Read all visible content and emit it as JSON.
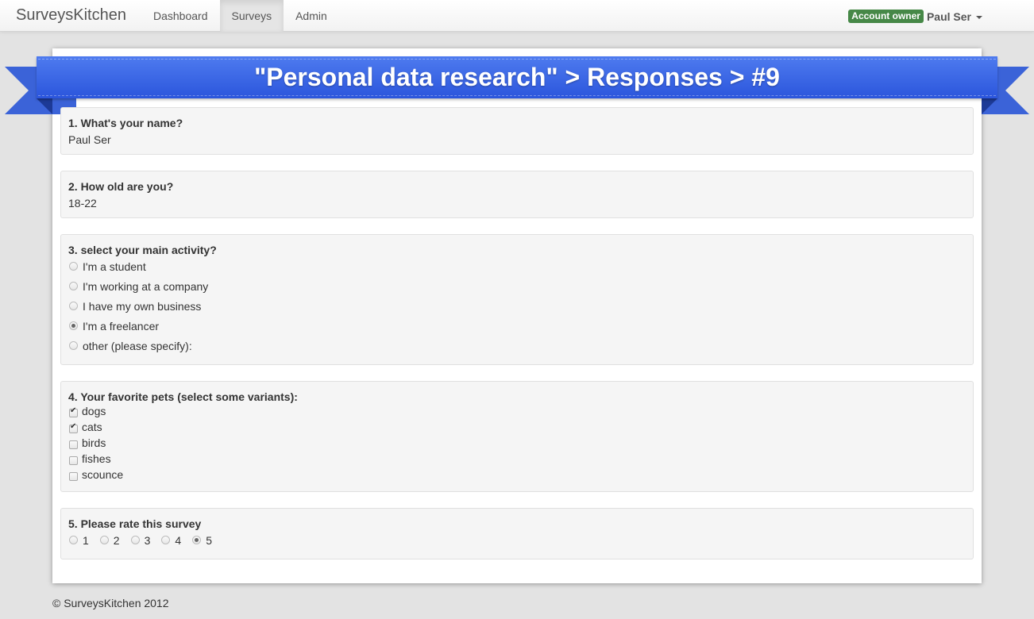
{
  "navbar": {
    "brand": "SurveysKitchen",
    "items": [
      {
        "label": "Dashboard",
        "active": false
      },
      {
        "label": "Surveys",
        "active": true
      },
      {
        "label": "Admin",
        "active": false
      }
    ],
    "badge": "Account owner",
    "user": "Paul Ser"
  },
  "ribbon": {
    "title": "\"Personal data research\" > Responses > #9"
  },
  "questions": {
    "q1": {
      "title": "1. What's your name?",
      "answer": "Paul Ser"
    },
    "q2": {
      "title": "2. How old are you?",
      "answer": "18-22"
    },
    "q3": {
      "title": "3. select your main activity?",
      "options": [
        "I'm a student",
        "I'm working at a company",
        "I have my own business",
        "I'm a freelancer",
        "other (please specify):"
      ],
      "selected": "I'm a freelancer"
    },
    "q4": {
      "title": "4. Your favorite pets (select some variants):",
      "options": [
        "dogs",
        "cats",
        "birds",
        "fishes",
        "scounce"
      ],
      "checked": [
        "dogs",
        "cats"
      ]
    },
    "q5": {
      "title": "5. Please rate this survey",
      "options": [
        "1",
        "2",
        "3",
        "4",
        "5"
      ],
      "selected": "5"
    }
  },
  "footer": {
    "text": "© SurveysKitchen 2012"
  },
  "colors": {
    "ribbon": "#2b55dc",
    "badge": "#468847"
  }
}
